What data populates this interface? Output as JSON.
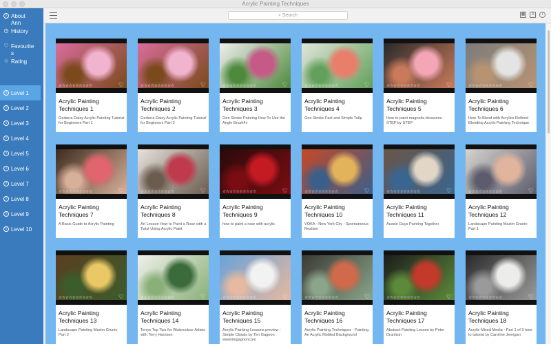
{
  "window": {
    "title": "Acrylic Painting Techniques"
  },
  "sidebar": {
    "links": [
      {
        "label": "About\nAnn",
        "icon": "info-icon"
      },
      {
        "label": "History",
        "icon": "history-icon"
      },
      {
        "label": "Favourite\ns",
        "icon": "heart-icon"
      },
      {
        "label": "Rating",
        "icon": "star-icon"
      }
    ],
    "levels": [
      "Level 1",
      "Level 2",
      "Level 3",
      "Level 4",
      "Level 5",
      "Level 6",
      "Level 7",
      "Level 8",
      "Level 9",
      "Level 10"
    ],
    "active_level": 0
  },
  "toolbar": {
    "search_placeholder": "Search",
    "views": [
      "grid-view-icon",
      "list-view-icon",
      "info-icon"
    ]
  },
  "cards": [
    {
      "title": "Acrylic Painting Techniques 1",
      "desc": "Gerbera Daisy Acrylic Painting Tutorial for Beginners Part 1",
      "stars": "☆☆☆☆☆☆☆☆☆☆",
      "colors": [
        "#d96d9c",
        "#f1b4cf",
        "#7a4a1c"
      ]
    },
    {
      "title": "Acrylic Painting Techniques 2",
      "desc": "Gerbera Daisy Acrylic Painting Tutorial for Beginners Part 2",
      "stars": "☆☆☆☆☆☆☆☆☆☆",
      "colors": [
        "#d96d9c",
        "#f1b4cf",
        "#7a4a1c"
      ]
    },
    {
      "title": "Acrylic Painting Techniques 3",
      "desc": "One Stroke Painting How To Use the Angle Brush4v",
      "stars": "☆☆☆☆☆☆☆☆☆☆",
      "colors": [
        "#eeeeee",
        "#c55a86",
        "#4f8a3c"
      ]
    },
    {
      "title": "Acrylic Painting Techniques 4",
      "desc": "One Stroke Fast and Simple Tulip",
      "stars": "☆☆☆☆☆☆☆☆☆☆",
      "colors": [
        "#dfe6da",
        "#e97e6a",
        "#63a05b"
      ]
    },
    {
      "title": "Acrylic Painting Techniques 5",
      "desc": "How to paint magnolia blossoms - STEP by STEP",
      "stars": "☆☆☆☆☆☆☆☆☆☆",
      "colors": [
        "#2a2a2a",
        "#f4a6b6",
        "#c97a5a"
      ]
    },
    {
      "title": "Acrylic Painting Techniques 6",
      "desc": "How To Blend with Acrylics Refined Blending Acrylic Painting Technique",
      "stars": "☆☆☆☆☆☆☆☆☆☆",
      "colors": [
        "#7c7c7c",
        "#e4e4e4",
        "#b89372"
      ]
    },
    {
      "title": "Acrylic Painting Techniques 7",
      "desc": "A Basic Guide to Acrylic Painting",
      "stars": "☆☆☆☆☆☆☆☆☆☆",
      "colors": [
        "#3d2b1e",
        "#e0656d",
        "#d7b09a"
      ]
    },
    {
      "title": "Acrylic Painting Techniques 8",
      "desc": "Art Lesson How to Paint a Rose with a Twist Using Acrylic Paint",
      "stars": "☆☆☆☆☆☆☆☆☆☆",
      "colors": [
        "#e6e2dc",
        "#c03a4d",
        "#6b5c4f"
      ]
    },
    {
      "title": "Acrylic Painting Techniques 9",
      "desc": "how to paint a rose with acrylic",
      "stars": "☆☆☆☆☆☆☆☆☆☆",
      "colors": [
        "#2a0a0a",
        "#c41a22",
        "#7a0d12"
      ]
    },
    {
      "title": "Acrylic Painting Techniques 10",
      "desc": "VOKA - New York City - Spontaneous Realism",
      "stars": "☆☆☆☆☆☆☆☆☆☆",
      "colors": [
        "#c64826",
        "#e3b35b",
        "#3b5f8a"
      ]
    },
    {
      "title": "Acrylic Painting Techniques 11",
      "desc": "Aussie Guys Painting Together",
      "stars": "☆☆☆☆☆☆☆☆☆☆",
      "colors": [
        "#6a5546",
        "#e2d7c7",
        "#3a6590"
      ]
    },
    {
      "title": "Acrylic Painting Techniques 12",
      "desc": "Landscape Painting Maxim Grunin Part 1",
      "stars": "☆☆☆☆☆☆☆☆☆☆",
      "colors": [
        "#d6d4ce",
        "#e0b49d",
        "#5c5c6c"
      ]
    },
    {
      "title": "Acrylic Painting Techniques 13",
      "desc": "Landscape Painting Maxim Grunin Part 2",
      "stars": "☆☆☆☆☆☆☆☆☆☆",
      "colors": [
        "#5a3e1f",
        "#e9c865",
        "#3b5d2c"
      ]
    },
    {
      "title": "Acrylic Painting Techniques 14",
      "desc": "Terrys Top Tips for Watercolour Artists with Terry Harrison",
      "stars": "☆☆☆☆☆☆☆☆☆☆",
      "colors": [
        "#f0f0ea",
        "#3b6b3b",
        "#8ab07a"
      ]
    },
    {
      "title": "Acrylic Painting Techniques 15",
      "desc": "Acrylic Painting Lessons preview - Simple Clouds by Tim Gagnon wwwtimgagnoncom",
      "stars": "☆☆☆☆☆☆☆☆☆☆",
      "colors": [
        "#6aa2d8",
        "#f2f2f2",
        "#e6b9a0"
      ]
    },
    {
      "title": "Acrylic Painting Techniques 16",
      "desc": "Acrylic Painting Techniques - Painting An Acrylic Mottled Background",
      "stars": "☆☆☆☆☆☆☆☆☆☆",
      "colors": [
        "#3b3a35",
        "#d16a4a",
        "#8aa58a"
      ]
    },
    {
      "title": "Acrylic Painting Techniques 17",
      "desc": "Abstract Painting Lesson by Peter Dranitsin",
      "stars": "☆☆☆☆☆☆☆☆☆☆",
      "colors": [
        "#1c1c1c",
        "#c33a2a",
        "#5c8a3a"
      ]
    },
    {
      "title": "Acrylic Painting Techniques 18",
      "desc": "Acrylic  Mixed Media - Part 1 of 3 how-to tutorial by Caroline Jernigan",
      "stars": "☆☆☆☆☆☆☆☆☆☆",
      "colors": [
        "#2a2a2a",
        "#ececea",
        "#9a9a9a"
      ]
    }
  ]
}
